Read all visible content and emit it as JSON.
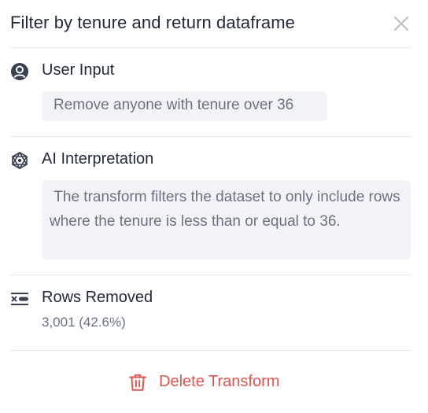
{
  "panel": {
    "title": "Filter by tenure and return dataframe"
  },
  "user_input": {
    "heading": "User Input",
    "value": "Remove anyone with tenure over 36"
  },
  "ai_interpretation": {
    "heading": "AI Interpretation",
    "text": " The transform filters the dataset to only include rows where the tenure is less than or equal to 36."
  },
  "rows_removed": {
    "heading": "Rows Removed",
    "value": "3,001 (42.6%)"
  },
  "actions": {
    "delete_label": "Delete Transform"
  },
  "icons": {
    "close": "close-icon",
    "user": "user-circle-icon",
    "ai": "ai-network-icon",
    "rows": "rows-removed-icon",
    "delete": "trash-icon"
  },
  "colors": {
    "text": "#1f2937",
    "muted": "#6b7280",
    "box_bg": "#f1f3f6",
    "danger": "#e0534f",
    "divider": "#e5e7eb"
  }
}
